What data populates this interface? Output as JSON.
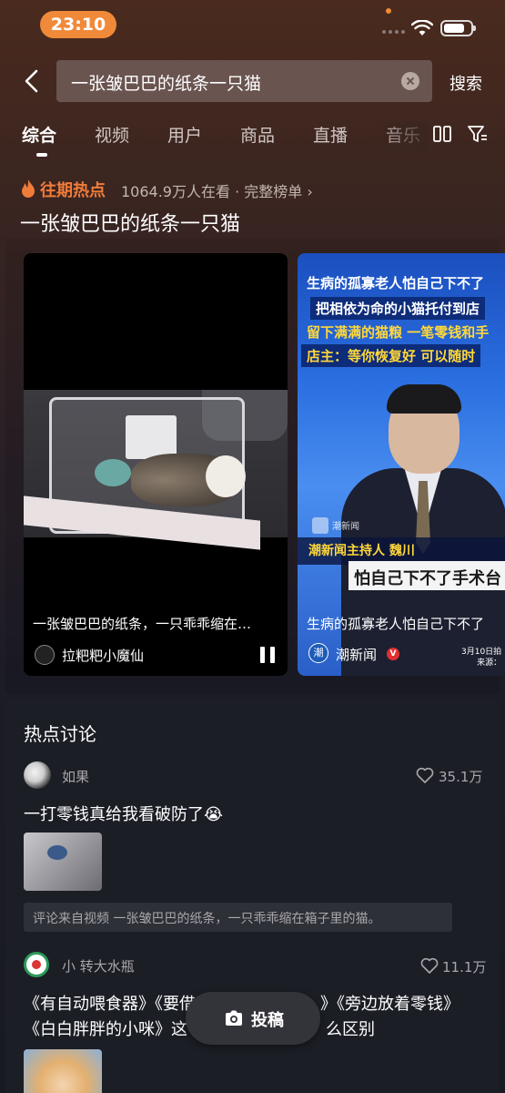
{
  "status": {
    "time": "23:10"
  },
  "search": {
    "query": "一张皱巴巴的纸条一只猫",
    "button_label": "搜索"
  },
  "tabs": [
    "综合",
    "视频",
    "用户",
    "商品",
    "直播",
    "音乐"
  ],
  "hot": {
    "label": "往期热点",
    "count_text": "1064.9万人在看 · 完整榜单 ›",
    "title": "一张皱巴巴的纸条一只猫"
  },
  "videos": [
    {
      "caption": "一张皱巴巴的纸条，一只乖乖缩在…",
      "author": "拉粑粑小魔仙"
    },
    {
      "overlay_lines": [
        "生病的孤寡老人怕自己下不了",
        "把相依为命的小猫托付到店",
        "留下满满的猫粮 一笔零钱和手",
        "店主：等你恢复好 可以随时"
      ],
      "logo_text": "潮新闻",
      "host_line": "潮新闻主持人 魏川",
      "subtitle": "怕自己下不了手术台",
      "caption": "生病的孤寡老人怕自己下不了",
      "author": "潮新闻",
      "verified_mark": "V",
      "date_text": "3月10日拍",
      "source_text": "来源："
    }
  ],
  "discussion": {
    "title": "热点讨论",
    "comments": [
      {
        "name": "如果",
        "likes": "35.1万",
        "text": "一打零钱真给我看破防了😭",
        "source": "评论来自视频 一张皱巴巴的纸条，一只乖乖缩在箱子里的猫。"
      },
      {
        "name": "小 转大水瓶",
        "likes": "11.1万",
        "line1": "《有自动喂食器》《要借",
        "line1b": "》《旁边放着零钱》",
        "line2": "《白白胖胖的小咪》这",
        "line2b": "么区别"
      }
    ]
  },
  "post_button": {
    "label": "投稿"
  },
  "colors": {
    "accent": "#f07c3a",
    "time_pill": "#f08a3a"
  },
  "icons": [
    "back-icon",
    "clear-icon",
    "grid-icon",
    "filter-icon",
    "fire-icon",
    "pause-icon",
    "heart-icon",
    "camera-icon",
    "verified-icon"
  ]
}
